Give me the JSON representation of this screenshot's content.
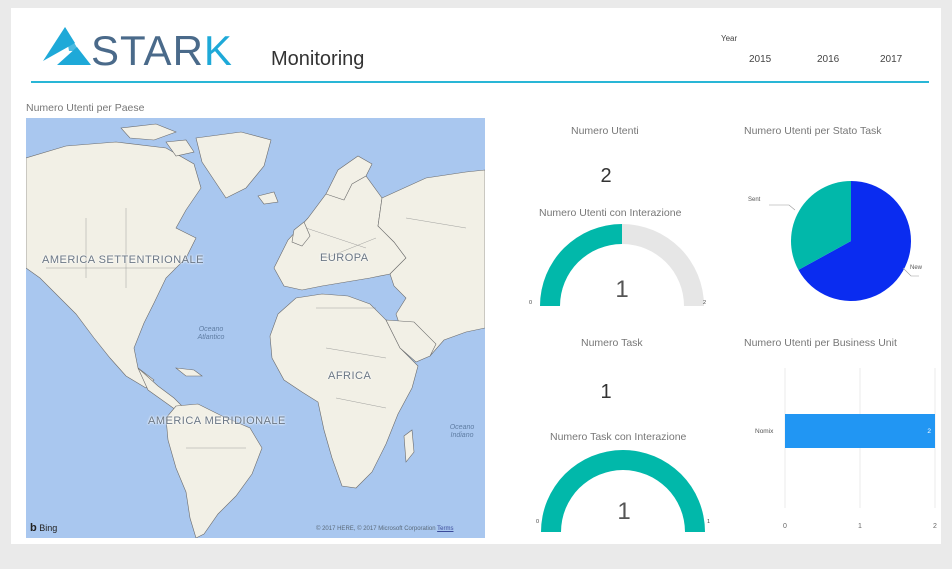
{
  "header": {
    "logo_text_main": "STAR",
    "logo_text_accent": "K",
    "page_title": "Monitoring"
  },
  "year_filter": {
    "label": "Year",
    "options": [
      "2015",
      "2016",
      "2017"
    ]
  },
  "map_visual": {
    "title": "Numero Utenti per Paese",
    "labels": {
      "north_america": "AMERICA SETTENTRIONALE",
      "europe": "EUROPA",
      "africa": "AFRICA",
      "south_america": "AMERICA MERIDIONALE",
      "atlantic": "Oceano Atlantico",
      "indian": "Oceano Indiano"
    },
    "bing": "Bing",
    "copyright": "© 2017 HERE, © 2017 Microsoft Corporation",
    "terms": "Terms"
  },
  "kpi_users": {
    "title": "Numero Utenti",
    "value": "2"
  },
  "gauge_users": {
    "title": "Numero Utenti con Interazione",
    "value": "1",
    "min": "0",
    "max": "2",
    "fill_fraction": 0.5,
    "colors": {
      "fill": "#01b8aa",
      "track": "#e6e6e6"
    }
  },
  "kpi_tasks": {
    "title": "Numero Task",
    "value": "1"
  },
  "gauge_tasks": {
    "title": "Numero Task con Interazione",
    "value": "1",
    "min": "0",
    "max": "1",
    "fill_fraction": 1.0,
    "colors": {
      "fill": "#01b8aa",
      "track": "#e6e6e6"
    }
  },
  "chart_data": [
    {
      "type": "pie",
      "title": "Numero Utenti per Stato Task",
      "categories": [
        "New",
        "Sent"
      ],
      "values": [
        0.67,
        0.33
      ],
      "colors": [
        "#0a2cf0",
        "#01b8aa"
      ]
    },
    {
      "type": "bar",
      "orientation": "horizontal",
      "title": "Numero Utenti per Business Unit",
      "categories": [
        "Nomix"
      ],
      "values": [
        2
      ],
      "data_labels": [
        "2"
      ],
      "x_ticks": [
        "0",
        "1",
        "2"
      ],
      "xlim": [
        0,
        2
      ],
      "colors": [
        "#2196f3"
      ]
    }
  ]
}
